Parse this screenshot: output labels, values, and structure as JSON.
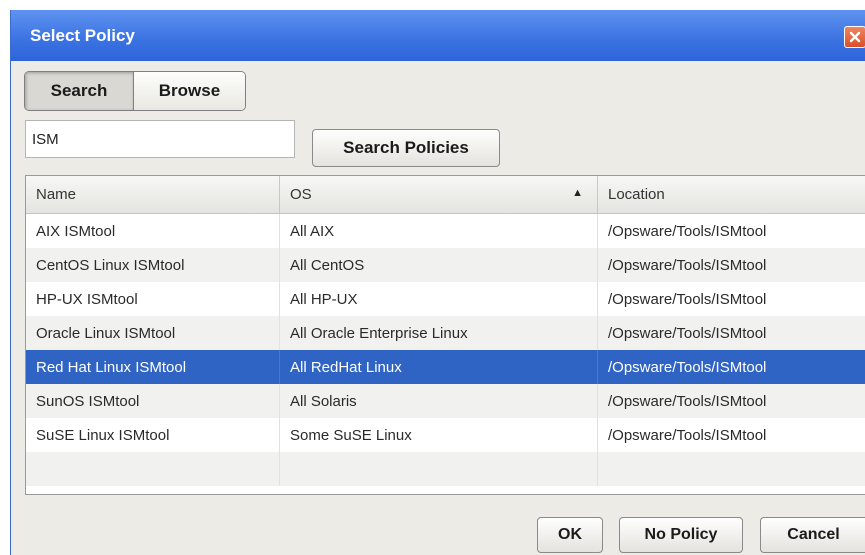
{
  "dialog": {
    "title": "Select Policy",
    "close_icon": "close-icon",
    "accent_color": "#3d74e3",
    "selection_color": "#2f63c4"
  },
  "mode_toggle": {
    "search_label": "Search",
    "browse_label": "Browse",
    "active": "Search"
  },
  "search": {
    "value": "ISM",
    "button_label": "Search Policies"
  },
  "table": {
    "columns": [
      "Name",
      "OS",
      "Location"
    ],
    "sort_column": "OS",
    "sort_icon": "sort-ascending-icon",
    "rows": [
      {
        "name": "AIX ISMtool",
        "os": "All AIX",
        "location": "/Opsware/Tools/ISMtool"
      },
      {
        "name": "CentOS Linux ISMtool",
        "os": "All CentOS",
        "location": "/Opsware/Tools/ISMtool"
      },
      {
        "name": "HP-UX ISMtool",
        "os": "All HP-UX",
        "location": "/Opsware/Tools/ISMtool"
      },
      {
        "name": "Oracle Linux ISMtool",
        "os": "All Oracle Enterprise Linux",
        "location": "/Opsware/Tools/ISMtool"
      },
      {
        "name": "Red Hat Linux ISMtool",
        "os": "All RedHat Linux",
        "location": "/Opsware/Tools/ISMtool"
      },
      {
        "name": "SunOS ISMtool",
        "os": "All Solaris",
        "location": "/Opsware/Tools/ISMtool"
      },
      {
        "name": "SuSE Linux ISMtool",
        "os": "Some SuSE Linux",
        "location": "/Opsware/Tools/ISMtool"
      }
    ],
    "selected_row": "Red Hat Linux ISMtool"
  },
  "footer": {
    "ok_label": "OK",
    "no_policy_label": "No Policy",
    "cancel_label": "Cancel"
  }
}
